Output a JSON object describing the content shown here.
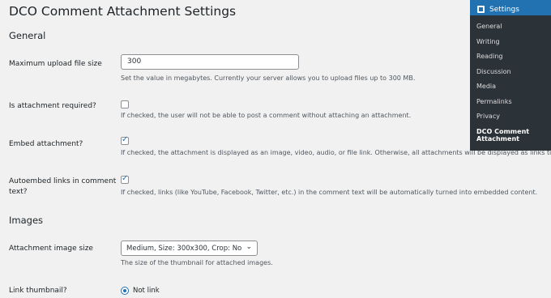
{
  "page_title": "DCO Comment Attachment Settings",
  "sections": {
    "general": "General",
    "images": "Images"
  },
  "fields": {
    "max_upload": {
      "label": "Maximum upload file size",
      "value": "300",
      "desc": "Set the value in megabytes. Currently your server allows you to upload files up to 300 MB."
    },
    "required": {
      "label": "Is attachment required?",
      "checked": false,
      "desc": "If checked, the user will not be able to post a comment without attaching an attachment."
    },
    "embed": {
      "label": "Embed attachment?",
      "checked": true,
      "desc": "If checked, the attachment is displayed as an image, video, audio, or file link. Otherwise, all attachments will be displayed as links to files."
    },
    "autoembed": {
      "label_line1": "Autoembed links in comment",
      "label_line2": "text?",
      "checked": true,
      "desc": "If checked, links (like YouTube, Facebook, Twitter, etc.) in the comment text will be automatically turned into embedded content."
    },
    "image_size": {
      "label": "Attachment image size",
      "selected": "Medium, Size: 300x300, Crop: No",
      "desc": "The size of the thumbnail for attached images."
    },
    "link_thumb": {
      "label": "Link thumbnail?",
      "option": "Not link",
      "selected": true
    }
  },
  "submenu": {
    "title": "Settings",
    "icon": "settings-icon",
    "items": [
      "General",
      "Writing",
      "Reading",
      "Discussion",
      "Media",
      "Permalinks",
      "Privacy"
    ],
    "current_line1": "DCO Comment",
    "current_line2": "Attachment"
  },
  "colors": {
    "accent": "#2271b1",
    "menu_bg": "#2c3338",
    "page_bg": "#f1f1f1"
  }
}
